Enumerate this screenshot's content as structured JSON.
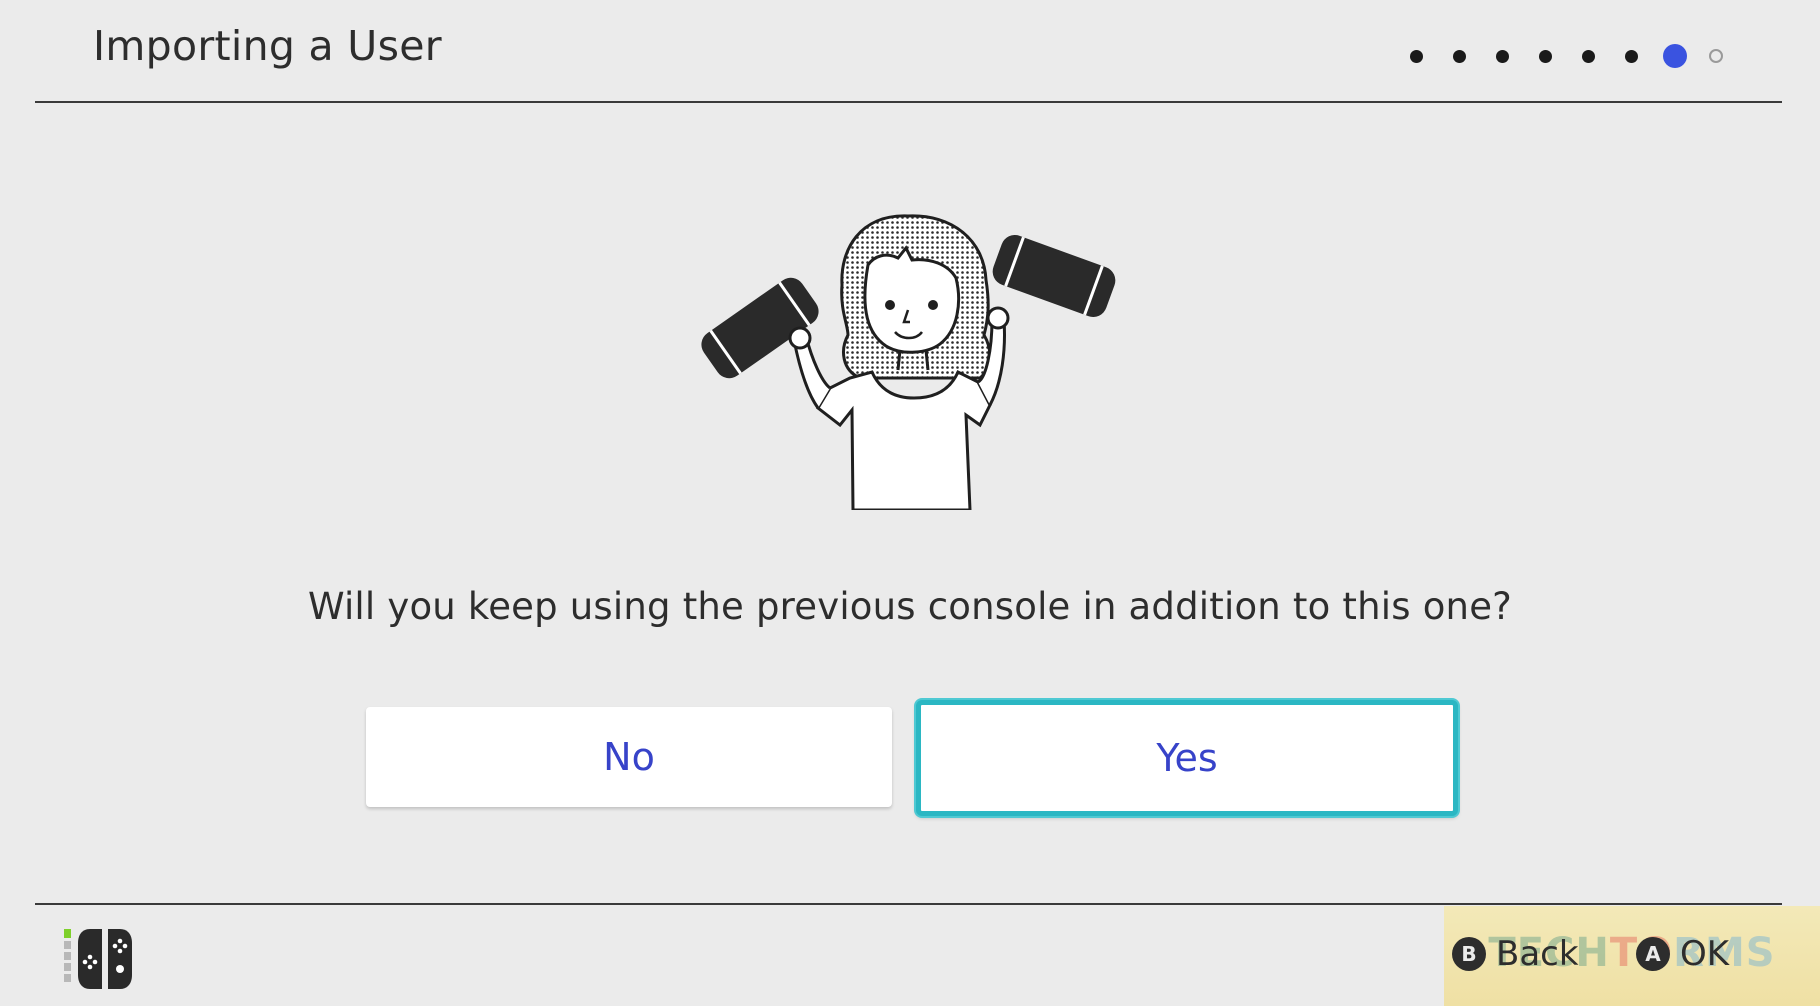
{
  "header": {
    "title": "Importing a User",
    "steps": {
      "total": 8,
      "current": 7
    }
  },
  "main": {
    "question": "Will you keep using the previous console in addition to this one?",
    "buttons": {
      "no_label": "No",
      "yes_label": "Yes"
    }
  },
  "footer": {
    "back_glyph": "B",
    "back_label": "Back",
    "ok_glyph": "A",
    "ok_label": "OK",
    "controller_icon": "joy-con-pair-icon"
  },
  "colors": {
    "accent": "#3a53e0",
    "selection": "#2bb7c3",
    "button_text": "#3743c9",
    "background": "#ebebeb"
  }
}
